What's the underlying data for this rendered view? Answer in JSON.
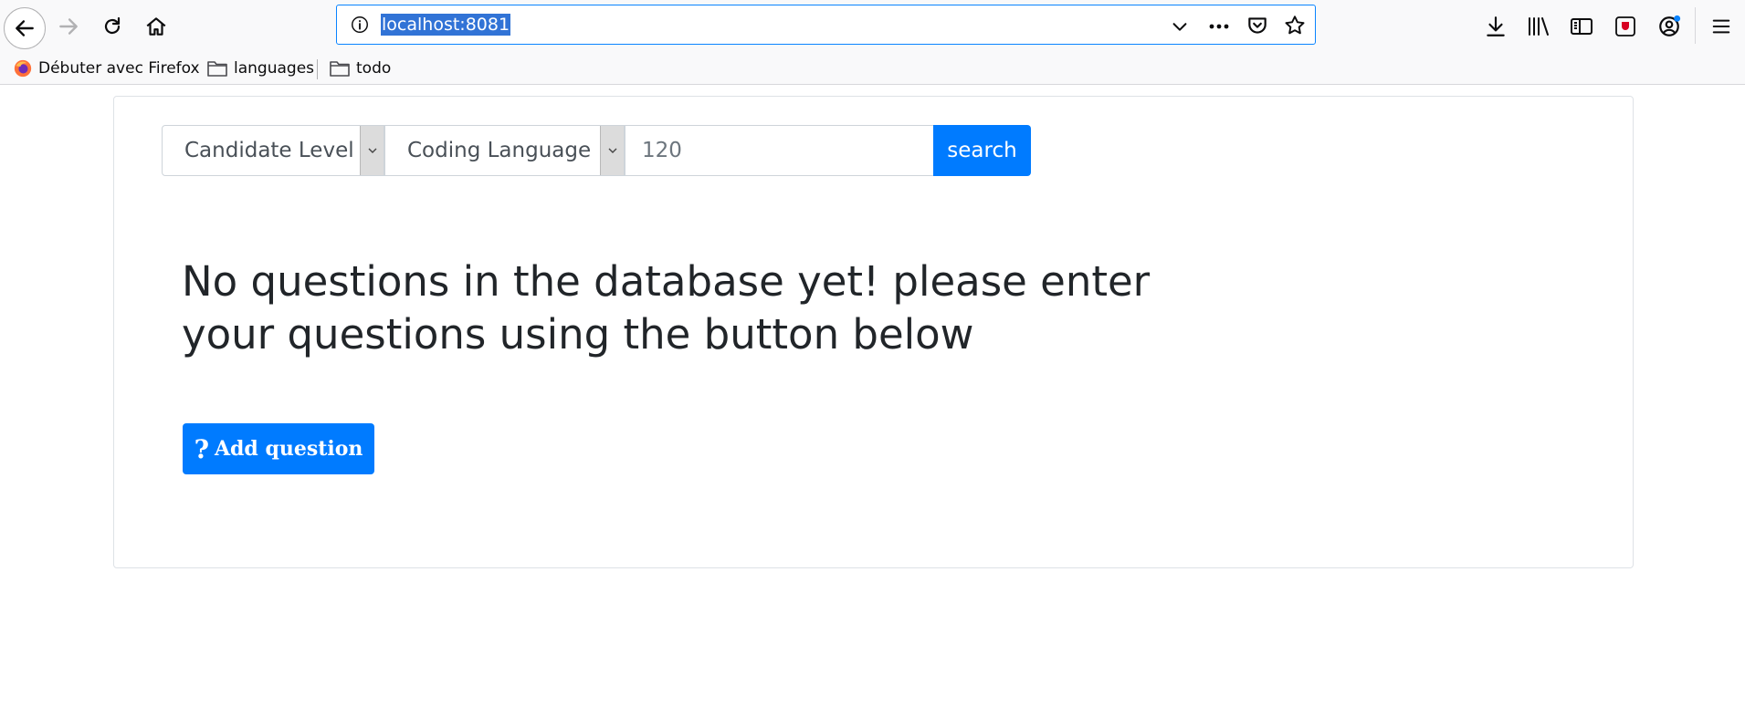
{
  "browser": {
    "url": "localhost:8081",
    "bookmarks": [
      {
        "label": "Débuter avec Firefox",
        "icon": "firefox-icon"
      },
      {
        "label": "languages",
        "icon": "folder-icon"
      },
      {
        "label": "todo",
        "icon": "folder-icon"
      }
    ]
  },
  "filters": {
    "level_label": "Candidate Level",
    "language_label": "Coding Language",
    "count_value": "120",
    "search_label": "search"
  },
  "empty_state": {
    "message": "No questions in the database yet! please enter your questions using the button below",
    "add_label": "Add question",
    "add_icon_glyph": "?"
  },
  "colors": {
    "primary": "#007bff",
    "url_highlight": "#3173d6",
    "url_focus_border": "#0a84ff"
  }
}
